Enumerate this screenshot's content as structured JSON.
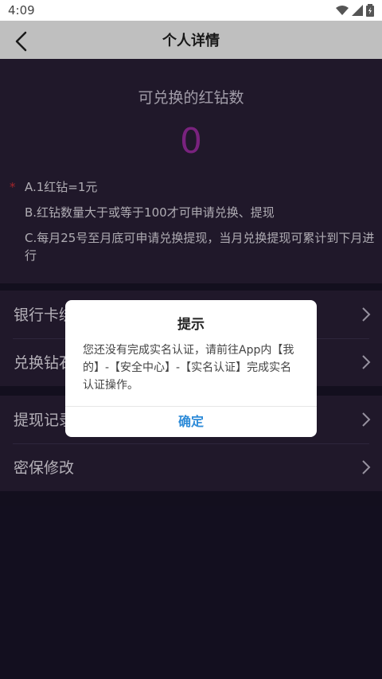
{
  "status_bar": {
    "time": "4:09"
  },
  "header": {
    "title": "个人详情"
  },
  "summary": {
    "label": "可兑换的红钻数",
    "value": "0",
    "notes": [
      "A.1红钻=1元",
      "B.红钻数量大于或等于100才可申请兑换、提现",
      "C.每月25号至月底可申请兑换提现，当月兑换提现可累计到下月进行"
    ],
    "star": "*"
  },
  "menu_group_1": [
    {
      "label": "银行卡绑定"
    },
    {
      "label": "兑换钻石"
    }
  ],
  "menu_group_2": [
    {
      "label": "提现记录"
    },
    {
      "label": "密保修改"
    }
  ],
  "dialog": {
    "title": "提示",
    "message": "您还没有完成实名认证，请前往App内【我的】-【安全中心】-【实名认证】完成实名认证操作。",
    "confirm": "确定"
  },
  "colors": {
    "background": "#1a1429",
    "panel": "#2b2038",
    "accent_value": "#a22ea8",
    "dialog_button": "#2e8bd8"
  }
}
